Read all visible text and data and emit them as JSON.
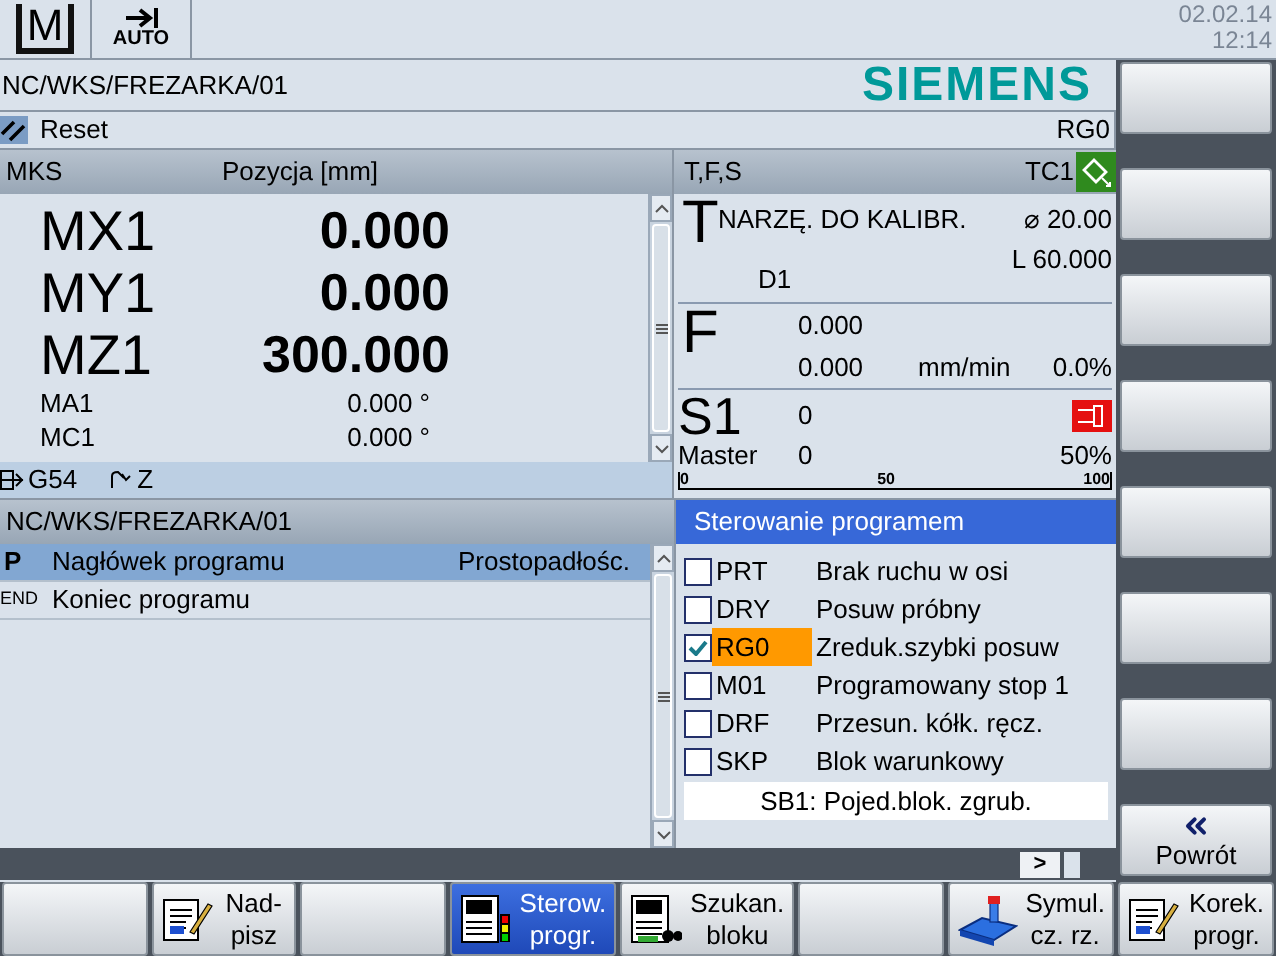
{
  "header": {
    "mode_icon": "M",
    "mode": "AUTO",
    "date": "02.02.14",
    "time": "12:14"
  },
  "path": "NC/WKS/FREZARKA/01",
  "logo": "SIEMENS",
  "status": {
    "state": "Reset",
    "channel_mode": "RG0"
  },
  "positions": {
    "columns": [
      "MKS",
      "Pozycja [mm]"
    ],
    "axes": [
      {
        "name": "MX1",
        "value": "0.000",
        "kind": "main"
      },
      {
        "name": "MY1",
        "value": "0.000",
        "kind": "main"
      },
      {
        "name": "MZ1",
        "value": "300.000",
        "kind": "main"
      },
      {
        "name": "MA1",
        "value": "0.000 °",
        "kind": "rotary"
      },
      {
        "name": "MC1",
        "value": "0.000 °",
        "kind": "rotary"
      }
    ],
    "work_offset": "G54",
    "rotation": "Z"
  },
  "tfs": {
    "title": "T,F,S",
    "tool_change": "TC1",
    "tool": {
      "letter": "T",
      "name": "NARZĘ. DO KALIBR.",
      "diameter": "⌀ 20.00",
      "length": "L 60.000",
      "edge": "D1"
    },
    "feed": {
      "letter": "F",
      "set_value": "0.000",
      "actual_value": "0.000",
      "unit": "mm/min",
      "override": "0.0%"
    },
    "spindle": {
      "letter": "S1",
      "speed": "0",
      "master_label": "Master",
      "master_value": "0",
      "override": "50%",
      "scale": [
        "0",
        "50",
        "100"
      ]
    }
  },
  "program": {
    "title": "NC/WKS/FREZARKA/01",
    "rows": [
      {
        "tag": "P",
        "text": "Nagłówek programu",
        "info": "Prostopadłośc.",
        "selected": true
      },
      {
        "tag": "END",
        "text": "Koniec programu",
        "selected": false
      }
    ]
  },
  "control": {
    "title": "Sterowanie programem",
    "options": [
      {
        "code": "PRT",
        "label": "Brak ruchu w osi",
        "checked": false,
        "selected": false
      },
      {
        "code": "DRY",
        "label": "Posuw próbny",
        "checked": false,
        "selected": false
      },
      {
        "code": "RG0",
        "label": "Zreduk.szybki posuw",
        "checked": true,
        "selected": true
      },
      {
        "code": "M01",
        "label": "Programowany stop 1",
        "checked": false,
        "selected": false
      },
      {
        "code": "DRF",
        "label": "Przesun. kółk. ręcz.",
        "checked": false,
        "selected": false
      },
      {
        "code": "SKP",
        "label": "Blok warunkowy",
        "checked": false,
        "selected": false
      }
    ],
    "single_block": "SB1: Pojed.blok. zgrub.",
    "more": ">"
  },
  "side_softkeys": [
    {
      "kind": "blank"
    },
    {
      "kind": "blank"
    },
    {
      "kind": "blank"
    },
    {
      "kind": "blank"
    },
    {
      "kind": "blank"
    },
    {
      "kind": "blank"
    },
    {
      "kind": "blank"
    },
    {
      "kind": "back",
      "label": "Powrót"
    }
  ],
  "bottom_softkeys": [
    {
      "kind": "blank",
      "selected": false
    },
    {
      "kind": "edit",
      "label": "Nad-\npisz",
      "selected": false
    },
    {
      "kind": "blank",
      "selected": false
    },
    {
      "kind": "control",
      "label": "Sterow.\nprogr.",
      "selected": true
    },
    {
      "kind": "search",
      "label": "Szukan.\nbloku",
      "selected": false
    },
    {
      "kind": "blank",
      "selected": false
    },
    {
      "kind": "simulate",
      "label": "Symul.\ncz. rz.",
      "selected": false
    },
    {
      "kind": "edit",
      "label": "Korek.\nprogr.",
      "selected": false
    }
  ]
}
